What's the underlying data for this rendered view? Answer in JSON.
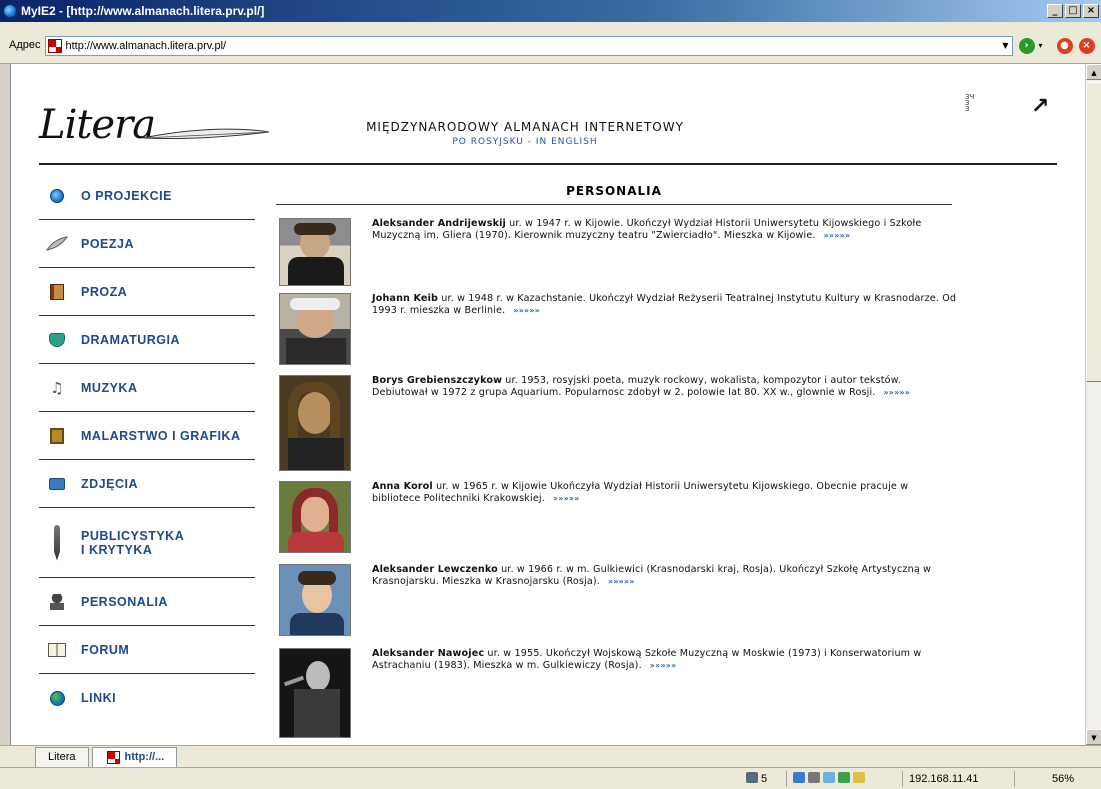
{
  "window": {
    "title": "MyIE2 - [http://www.almanach.litera.prv.pl/]",
    "min": "_",
    "max": "□",
    "close": "×"
  },
  "address": {
    "label": "Адрес",
    "url": "http://www.almanach.litera.prv.pl/"
  },
  "site": {
    "logo": "Litera",
    "title": "MIĘDZYNARODOWY ALMANACH INTERNETOWY",
    "lang_ru": "PO ROSYJSKU",
    "lang_sep": " - ",
    "lang_en": "IN ENGLISH",
    "corner_mark": "ЗЧ\nЗ\nЗ",
    "top_arrow": "↗"
  },
  "nav": {
    "items": [
      {
        "label": "O PROJEKCIE",
        "icon": "info-circle-icon"
      },
      {
        "label": "POEZJA",
        "icon": "feather-icon"
      },
      {
        "label": "PROZA",
        "icon": "book-icon"
      },
      {
        "label": "DRAMATURGIA",
        "icon": "theater-mask-icon"
      },
      {
        "label": "MUZYKA",
        "icon": "music-note-icon"
      },
      {
        "label": "MALARSTWO I GRAFIKA",
        "icon": "picture-frame-icon"
      },
      {
        "label": "ZDJĘCIA",
        "icon": "camera-icon"
      },
      {
        "label": "PUBLICYSTYKA\nI KRYTYKA",
        "icon": "fountain-pen-icon"
      },
      {
        "label": "PERSONALIA",
        "icon": "person-bust-icon"
      },
      {
        "label": "FORUM",
        "icon": "open-book-icon"
      },
      {
        "label": "LINKI",
        "icon": "globe-icon"
      }
    ]
  },
  "content": {
    "title": "PERSONALIA",
    "more": "»»»»»",
    "people": [
      {
        "name": "Aleksander Andrijewskij",
        "bio": " ur. w 1947 r. w Kijowie. Ukończył Wydział Historii Uniwersytetu Kijowskiego i Szkołe Muzyczną im. Gliera (1970). Kierownik muzyczny teatru \"Zwierciadło\". Mieszka w Kijowie."
      },
      {
        "name": "Johann Keib",
        "bio": " ur. w 1948 r. w Kazachstanie. Ukończył Wydział Reżyserii Teatralnej Instytutu Kultury w Krasnodarze. Od 1993 r. mieszka w Berlinie."
      },
      {
        "name": "Borys Grebienszczykow",
        "bio": " ur. 1953, rosyjski poeta, muzyk rockowy, wokalista, kompozytor i autor tekstów. Debiutował w 1972 z grupa Aquarium. Popularnosc zdobył w 2. polowie lat 80. XX w., glownie w Rosji."
      },
      {
        "name": "Anna Korol",
        "bio": " ur. w 1965 r. w Kijowie Ukończyła Wydział Historii Uniwersytetu Kijowskiego. Obecnie pracuje w bibliotece Politechniki Krakowskiej."
      },
      {
        "name": "Aleksander Lewczenko",
        "bio": " ur. w 1966 r. w m. Gulkiewici (Krasnodarski kraj, Rosja). Ukończył Szkołę Artystyczną w Krasnojarsku. Mieszka w Krasnojarsku (Rosja)."
      },
      {
        "name": "Aleksander Nawojec",
        "bio": " ur. w 1955. Ukończył Wojskową Szkołe Muzyczną w Moskwie (1973) i Konserwatorium w Astrachaniu (1983). Mieszka w m. Gulkiewiczy (Rosja)."
      }
    ]
  },
  "tabs": [
    {
      "label": "Litera"
    },
    {
      "label": "http://..."
    }
  ],
  "status": {
    "count": "5",
    "ip": "192.168.11.41",
    "zoom": "56%"
  }
}
